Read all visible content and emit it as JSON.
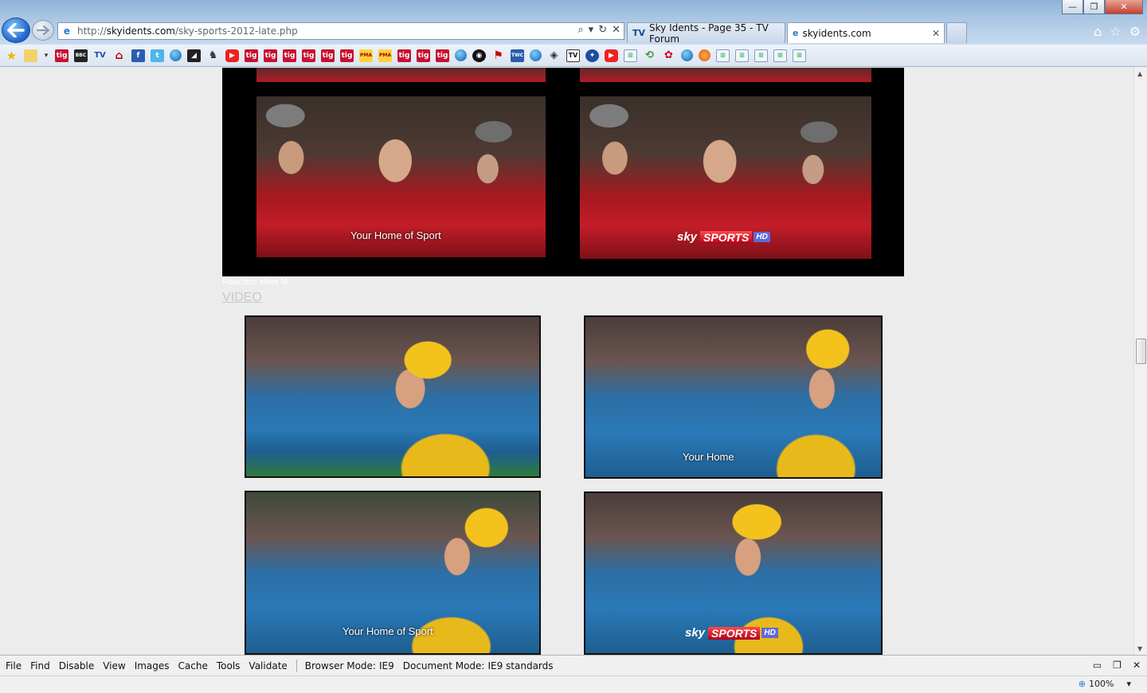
{
  "browser": {
    "url_protocol": "http://",
    "url_host": "skyidents.com",
    "url_path": "/sky-sports-2012-late.php",
    "tabs": [
      {
        "label": "Sky Idents - Page 35 - TV Forum",
        "icon": "TV"
      },
      {
        "label": "skyidents.com",
        "icon": "e"
      }
    ],
    "window_controls": {
      "minimize": "—",
      "restore": "❐",
      "close": "✕"
    }
  },
  "favorites": {
    "tig_label": "tig",
    "pma_label": "PMA",
    "bbc_label": "BBC",
    "tv_label": "TV",
    "facebook_label": "f",
    "twitter_label": "t",
    "tvv_label": "TV"
  },
  "content": {
    "frame_captions": {
      "your_home": "Your Home of Sport",
      "your_home_short": "Your Home"
    },
    "sky_logo": {
      "sky": "sky",
      "sports": "SPORTS",
      "hd": "HD"
    },
    "picture_label": "Reaction ident M",
    "video_link": "VIDEO"
  },
  "dev_toolbar": {
    "items": [
      "File",
      "Find",
      "Disable",
      "View",
      "Images",
      "Cache",
      "Tools",
      "Validate"
    ],
    "browser_mode_label": "Browser Mode:",
    "browser_mode_value": "IE9",
    "document_mode_label": "Document Mode:",
    "document_mode_value": "IE9 standards"
  },
  "status": {
    "zoom": "100%"
  }
}
